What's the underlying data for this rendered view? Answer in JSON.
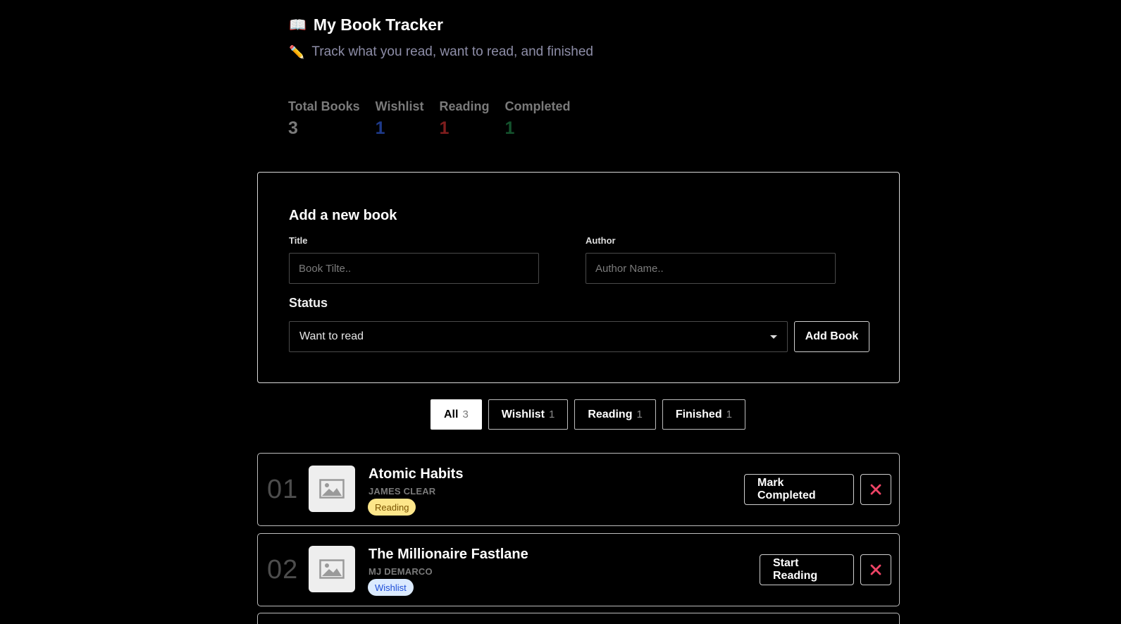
{
  "header": {
    "title_icon": "📖",
    "title": "My Book Tracker",
    "subtitle_icon": "✏️",
    "subtitle": "Track what you read, want to read, and finished"
  },
  "stats": {
    "total": {
      "label": "Total Books",
      "value": "3",
      "color": "#7a7a7a"
    },
    "wishlist": {
      "label": "Wishlist",
      "value": "1",
      "color": "#1e3a8a"
    },
    "reading": {
      "label": "Reading",
      "value": "1",
      "color": "#7f1d1d"
    },
    "completed": {
      "label": "Completed",
      "value": "1",
      "color": "#14532d"
    }
  },
  "form": {
    "heading": "Add a new book",
    "title_label": "Title",
    "title_placeholder": "Book Tilte..",
    "author_label": "Author",
    "author_placeholder": "Author Name..",
    "status_label": "Status",
    "status_selected": "Want to read",
    "add_button": "Add Book"
  },
  "filters": [
    {
      "label": "All",
      "count": "3",
      "active": true
    },
    {
      "label": "Wishlist",
      "count": "1",
      "active": false
    },
    {
      "label": "Reading",
      "count": "1",
      "active": false
    },
    {
      "label": "Finished",
      "count": "1",
      "active": false
    }
  ],
  "books": [
    {
      "number": "01",
      "title": "Atomic Habits",
      "author": "JAMES CLEAR",
      "status": "Reading",
      "status_bg": "#fde68a",
      "status_color": "#7a5300",
      "action": "Mark Completed"
    },
    {
      "number": "02",
      "title": "The Millionaire Fastlane",
      "author": "MJ DEMARCO",
      "status": "Wishlist",
      "status_bg": "#dbeafe",
      "status_color": "#1d4ed8",
      "action": "Start Reading"
    }
  ],
  "icons": {
    "cover": "image-placeholder-icon",
    "delete": "close-icon",
    "delete_color": "#ef4466"
  }
}
